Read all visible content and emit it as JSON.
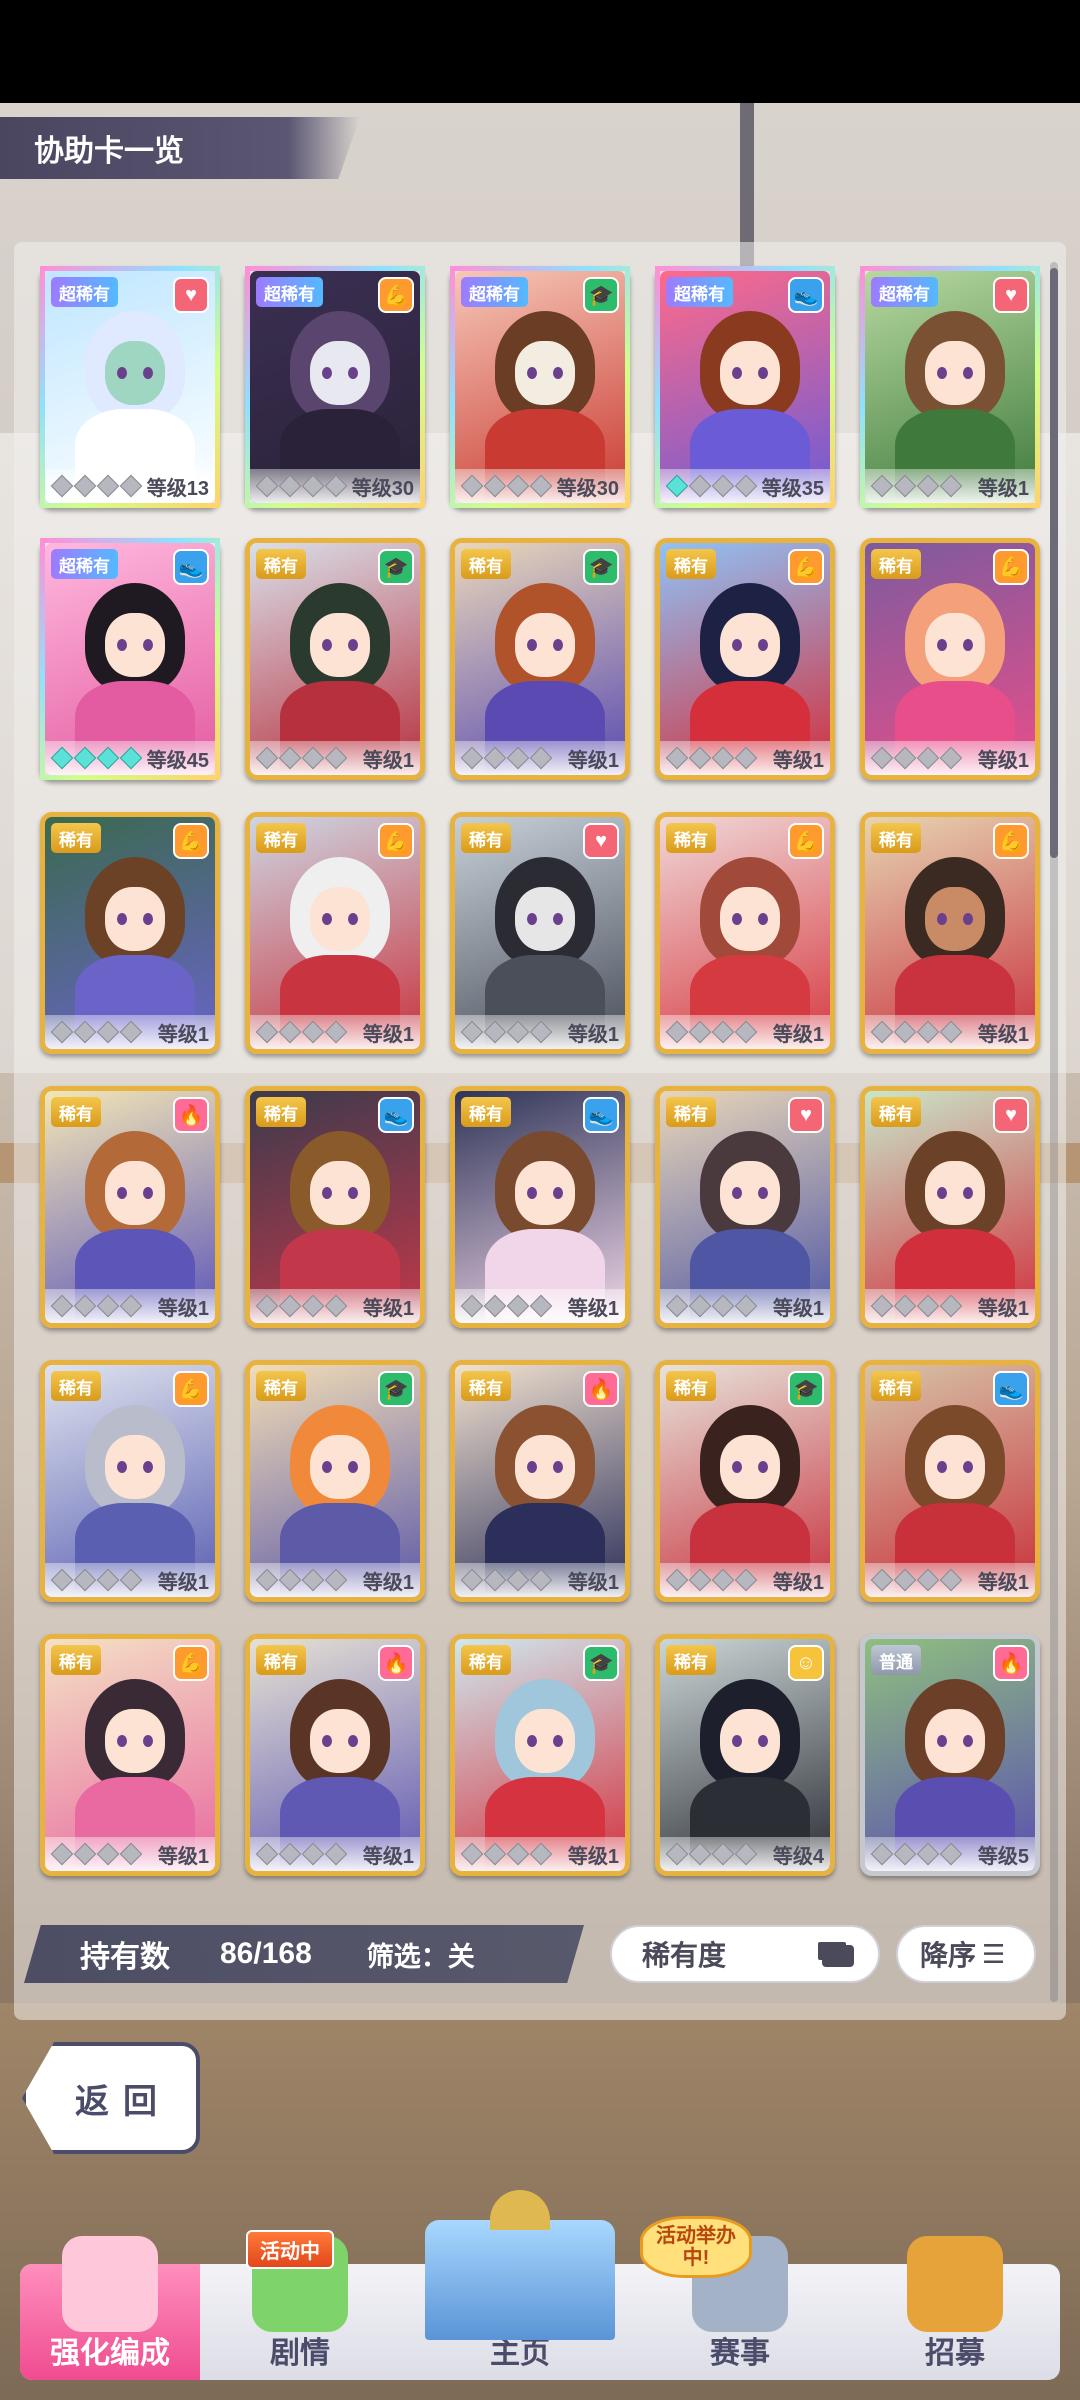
{
  "title": "协助卡一览",
  "cards": [
    {
      "rarity": "超稀有",
      "tier": "ssr",
      "type": "heart",
      "stars": 0,
      "level": "等级13",
      "palette": [
        "#bfe6ff",
        "#dfe9ff",
        "#9ed6c1",
        "#ffffff"
      ]
    },
    {
      "rarity": "超稀有",
      "tier": "ssr",
      "type": "power",
      "stars": 0,
      "level": "等级30",
      "palette": [
        "#3b2f52",
        "#59456e",
        "#e8e8f0",
        "#2a2238"
      ]
    },
    {
      "rarity": "超稀有",
      "tier": "ssr",
      "type": "wise",
      "stars": 0,
      "level": "等级30",
      "palette": [
        "#f6c7b7",
        "#6b3d24",
        "#f3ece0",
        "#c93a32"
      ]
    },
    {
      "rarity": "超稀有",
      "tier": "ssr",
      "type": "speed",
      "stars": 1,
      "level": "等级35",
      "palette": [
        "#ff6a89",
        "#8a3a1e",
        "#fde3d3",
        "#6b5bd6"
      ]
    },
    {
      "rarity": "超稀有",
      "tier": "ssr",
      "type": "heart",
      "stars": 0,
      "level": "等级1",
      "palette": [
        "#b7d9a0",
        "#7a5233",
        "#fde3d3",
        "#3f7a3c"
      ]
    },
    {
      "rarity": "超稀有",
      "tier": "ssr",
      "type": "speed",
      "stars": 4,
      "level": "等级45",
      "palette": [
        "#ffb8de",
        "#1f1a22",
        "#fde3d3",
        "#e35ba0"
      ]
    },
    {
      "rarity": "稀有",
      "tier": "r",
      "type": "wise",
      "stars": 0,
      "level": "等级1",
      "palette": [
        "#d9dfe9",
        "#2b3a2f",
        "#fde3d3",
        "#b7303d"
      ]
    },
    {
      "rarity": "稀有",
      "tier": "r",
      "type": "wise",
      "stars": 0,
      "level": "等级1",
      "palette": [
        "#e9d7b9",
        "#b0532a",
        "#fde3d3",
        "#5a4ab1"
      ]
    },
    {
      "rarity": "稀有",
      "tier": "r",
      "type": "power",
      "stars": 0,
      "level": "等级1",
      "palette": [
        "#8fc2f7",
        "#1d2244",
        "#fde3d3",
        "#d42f3b"
      ]
    },
    {
      "rarity": "稀有",
      "tier": "r",
      "type": "power",
      "stars": 0,
      "level": "等级1",
      "palette": [
        "#7c5b9e",
        "#f4a07a",
        "#fde3d3",
        "#e84e8a"
      ]
    },
    {
      "rarity": "稀有",
      "tier": "r",
      "type": "power",
      "stars": 0,
      "level": "等级1",
      "palette": [
        "#3a6a4e",
        "#6b4226",
        "#fde3d3",
        "#6a64c8"
      ]
    },
    {
      "rarity": "稀有",
      "tier": "r",
      "type": "power",
      "stars": 0,
      "level": "等级1",
      "palette": [
        "#cdd6e2",
        "#efefef",
        "#fde3d3",
        "#c8343f"
      ]
    },
    {
      "rarity": "稀有",
      "tier": "r",
      "type": "heart",
      "stars": 0,
      "level": "等级1",
      "palette": [
        "#c7d0d9",
        "#2b2b33",
        "#e6e6e6",
        "#4a4f5a"
      ]
    },
    {
      "rarity": "稀有",
      "tier": "r",
      "type": "power",
      "stars": 0,
      "level": "等级1",
      "palette": [
        "#f0d8d8",
        "#a24a3a",
        "#fde3d3",
        "#d63a41"
      ]
    },
    {
      "rarity": "稀有",
      "tier": "r",
      "type": "power",
      "stars": 0,
      "level": "等级1",
      "palette": [
        "#e6d4b1",
        "#3b2a22",
        "#c98b65",
        "#c9333f"
      ]
    },
    {
      "rarity": "稀有",
      "tier": "r",
      "type": "guts",
      "stars": 0,
      "level": "等级1",
      "palette": [
        "#f3e6b6",
        "#b36a38",
        "#fde3d3",
        "#5c56b8"
      ]
    },
    {
      "rarity": "稀有",
      "tier": "r",
      "type": "speed",
      "stars": 0,
      "level": "等级1",
      "palette": [
        "#3b3b4c",
        "#8a5a2a",
        "#fde3d3",
        "#c2384a"
      ]
    },
    {
      "rarity": "稀有",
      "tier": "r",
      "type": "speed",
      "stars": 0,
      "level": "等级1",
      "palette": [
        "#2f3558",
        "#7a4a2e",
        "#fde3d3",
        "#f0d6e8"
      ]
    },
    {
      "rarity": "稀有",
      "tier": "r",
      "type": "heart",
      "stars": 0,
      "level": "等级1",
      "palette": [
        "#e8d6b8",
        "#4a3a3e",
        "#fde3d3",
        "#4f57a5"
      ]
    },
    {
      "rarity": "稀有",
      "tier": "r",
      "type": "heart",
      "stars": 0,
      "level": "等级1",
      "palette": [
        "#c9e6c9",
        "#6b4228",
        "#fde3d3",
        "#d12f3c"
      ]
    },
    {
      "rarity": "稀有",
      "tier": "r",
      "type": "power",
      "stars": 0,
      "level": "等级1",
      "palette": [
        "#dfe3ee",
        "#b9bccb",
        "#fde3d3",
        "#5a5fb2"
      ]
    },
    {
      "rarity": "稀有",
      "tier": "r",
      "type": "wise",
      "stars": 0,
      "level": "等级1",
      "palette": [
        "#f2ddb6",
        "#f08a3a",
        "#fde3d3",
        "#5d5aa8"
      ]
    },
    {
      "rarity": "稀有",
      "tier": "r",
      "type": "guts",
      "stars": 0,
      "level": "等级1",
      "palette": [
        "#f1e1cf",
        "#8b5231",
        "#fde3d3",
        "#2b2f5a"
      ]
    },
    {
      "rarity": "稀有",
      "tier": "r",
      "type": "wise",
      "stars": 0,
      "level": "等级1",
      "palette": [
        "#e7e3da",
        "#3a221f",
        "#fde3d3",
        "#c8323e"
      ]
    },
    {
      "rarity": "稀有",
      "tier": "r",
      "type": "speed",
      "stars": 0,
      "level": "等级1",
      "palette": [
        "#d7c4a8",
        "#7a4a2a",
        "#fde3d3",
        "#c8303a"
      ]
    },
    {
      "rarity": "稀有",
      "tier": "r",
      "type": "power",
      "stars": 0,
      "level": "等级1",
      "palette": [
        "#f4e1c4",
        "#3a2a36",
        "#fde3d3",
        "#e86aa0"
      ]
    },
    {
      "rarity": "稀有",
      "tier": "r",
      "type": "guts",
      "stars": 0,
      "level": "等级1",
      "palette": [
        "#e6e1d3",
        "#5a3424",
        "#fde3d3",
        "#6059b3"
      ]
    },
    {
      "rarity": "稀有",
      "tier": "r",
      "type": "wise",
      "stars": 0,
      "level": "等级1",
      "palette": [
        "#cfe7ee",
        "#9fc6db",
        "#fde3d3",
        "#d4333f"
      ]
    },
    {
      "rarity": "稀有",
      "tier": "r",
      "type": "friend",
      "stars": 0,
      "level": "等级4",
      "palette": [
        "#cbd6d6",
        "#1e1f2d",
        "#fde3d3",
        "#2c2e36"
      ]
    },
    {
      "rarity": "普通",
      "tier": "n",
      "type": "guts",
      "stars": 0,
      "level": "等级5",
      "palette": [
        "#8fbf7f",
        "#6b3f28",
        "#fde3d3",
        "#5a4fb0"
      ]
    }
  ],
  "footer": {
    "owned_label": "持有数",
    "owned_value": "86/168",
    "filter_label": "筛选：关",
    "sort_field": "稀有度",
    "sort_order": "降序"
  },
  "back_label": "返回",
  "nav": [
    {
      "label": "强化编成",
      "active": true
    },
    {
      "label": "剧情",
      "active": false,
      "badge": "活动中"
    },
    {
      "label": "主页",
      "active": false
    },
    {
      "label": "赛事",
      "active": false,
      "badge": "活动举办中!"
    },
    {
      "label": "招募",
      "active": false
    }
  ],
  "type_icons": {
    "heart": "heart-icon",
    "power": "power-icon",
    "wise": "wisdom-icon",
    "speed": "speed-icon",
    "guts": "guts-icon",
    "friend": "friend-icon"
  },
  "type_glyphs": {
    "heart": "♥",
    "power": "💪",
    "wise": "🎓",
    "speed": "👟",
    "guts": "🔥",
    "friend": "☺"
  }
}
